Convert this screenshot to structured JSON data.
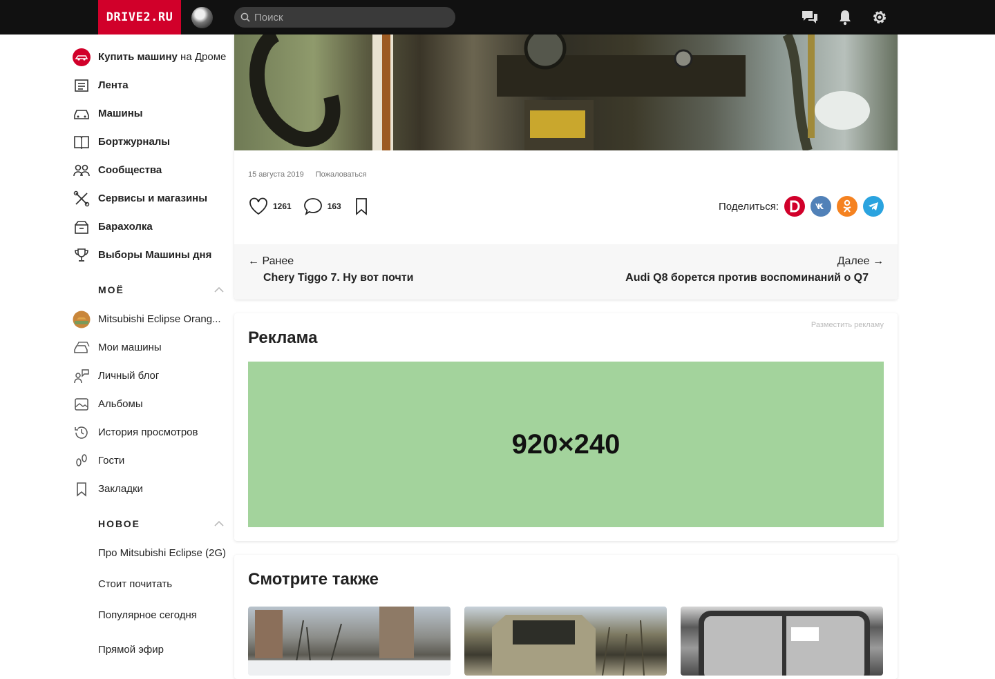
{
  "header": {
    "logo": "DRIVE2.RU",
    "search_placeholder": "Поиск",
    "icons": [
      "chat-icon",
      "bell-icon",
      "gear-icon"
    ],
    "brand_color": "#d1002a"
  },
  "sidebar": {
    "buy_bold": "Купить машину",
    "buy_rest": " на Дроме",
    "items": [
      {
        "label": "Лента",
        "icon": "feed-icon"
      },
      {
        "label": "Машины",
        "icon": "car-icon"
      },
      {
        "label": "Бортжурналы",
        "icon": "logbook-icon"
      },
      {
        "label": "Сообщества",
        "icon": "people-icon"
      },
      {
        "label": "Сервисы и магазины",
        "icon": "tools-icon"
      },
      {
        "label": "Барахолка",
        "icon": "box-icon"
      },
      {
        "label": "Выборы Машины дня",
        "icon": "trophy-icon"
      }
    ],
    "my_heading": "МОЁ",
    "my_items": [
      {
        "label": "Mitsubishi Eclipse Orang...",
        "icon": "car-avatar-icon"
      },
      {
        "label": "Мои машины",
        "icon": "cars-icon"
      },
      {
        "label": "Личный блог",
        "icon": "blog-icon"
      },
      {
        "label": "Альбомы",
        "icon": "album-icon"
      },
      {
        "label": "История просмотров",
        "icon": "history-icon"
      },
      {
        "label": "Гости",
        "icon": "footprints-icon"
      },
      {
        "label": "Закладки",
        "icon": "bookmark-icon"
      }
    ],
    "new_heading": "НОВОЕ",
    "new_items": [
      "Про Mitsubishi Eclipse (2G)",
      "Стоит почитать",
      "Популярное сегодня",
      "Прямой эфир"
    ]
  },
  "post": {
    "date": "15 августа 2019",
    "report": "Пожаловаться",
    "likes": "1261",
    "comments": "163",
    "share_label": "Поделиться:",
    "share_buttons": [
      {
        "name": "drive2",
        "glyph": "D",
        "color": "#d1002a"
      },
      {
        "name": "vk",
        "glyph": "vk",
        "color": "#5181b8"
      },
      {
        "name": "odnoklassniki",
        "glyph": "ok",
        "color": "#f58220"
      },
      {
        "name": "telegram",
        "glyph": "tg",
        "color": "#2aa3df"
      }
    ],
    "prev_label": "← Ранее",
    "prev_title": "Chery Tiggo 7. Ну вот почти",
    "next_label": "Далее →",
    "next_title": "Audi Q8 борется против воспоминаний о Q7"
  },
  "ad": {
    "title": "Реклама",
    "place_link": "Разместить рекламу",
    "banner_text": "920×240",
    "banner_color": "#a3d39c"
  },
  "see_also": {
    "title": "Смотрите также"
  }
}
